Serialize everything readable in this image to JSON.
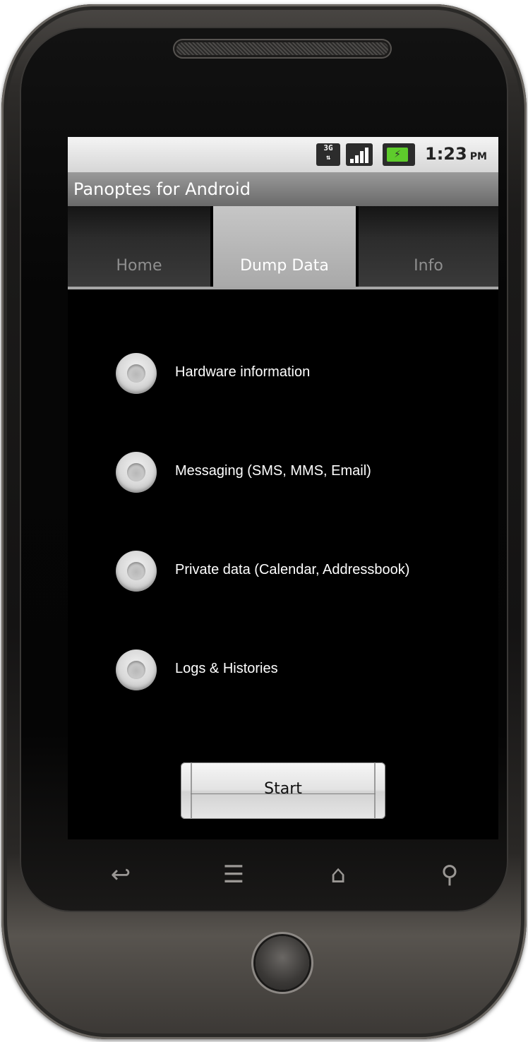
{
  "status_bar": {
    "network_label": "3G",
    "time": "1:23",
    "ampm": "PM",
    "icons": [
      "3g-icon",
      "signal-icon",
      "battery-charging-icon"
    ]
  },
  "app": {
    "title": "Panoptes for Android"
  },
  "tabs": [
    {
      "label": "Home",
      "active": false
    },
    {
      "label": "Dump Data",
      "active": true
    },
    {
      "label": "Info",
      "active": false
    }
  ],
  "options": [
    {
      "label": "Hardware information",
      "checked": false
    },
    {
      "label": "Messaging (SMS, MMS, Email)",
      "checked": false
    },
    {
      "label": "Private data (Calendar, Addressbook)",
      "checked": false
    },
    {
      "label": "Logs & Histories",
      "checked": false
    }
  ],
  "start_button": {
    "label": "Start"
  },
  "softkeys": {
    "back": "back-icon",
    "menu": "menu-icon",
    "home": "home-icon",
    "search": "search-icon"
  },
  "colors": {
    "battery_accent": "#5ecc2c",
    "active_tab": "#b5b5b5",
    "titlebar": "#7e7e7e"
  }
}
